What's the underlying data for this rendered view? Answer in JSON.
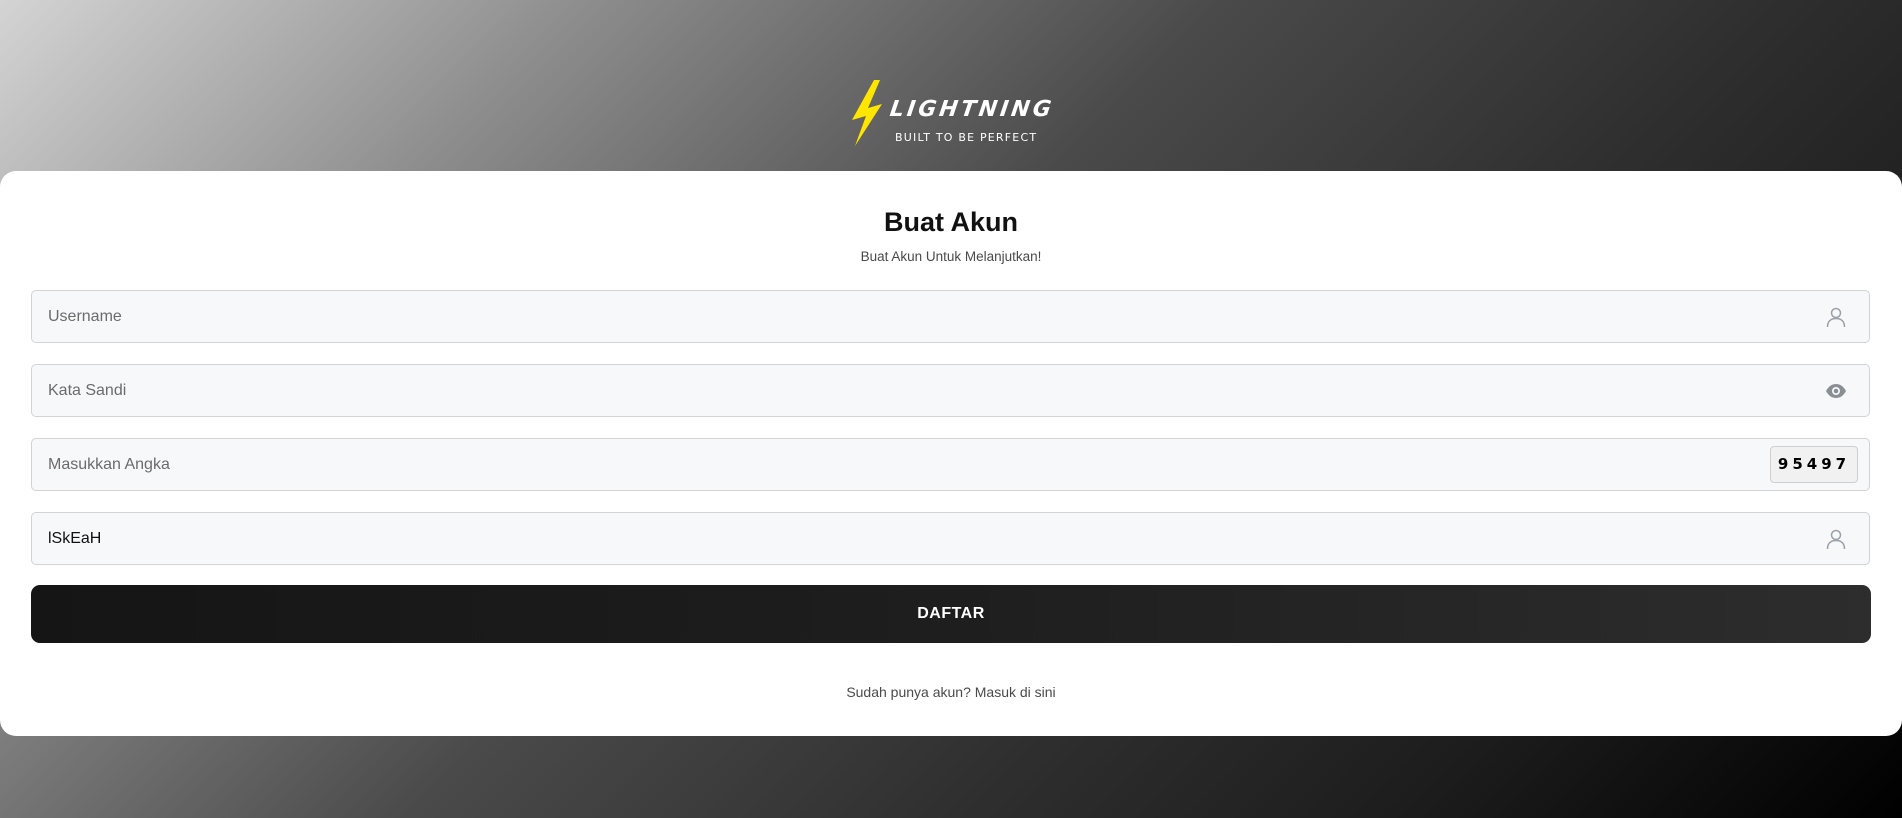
{
  "logo": {
    "wordmark": "LIGHTNING",
    "tagline": "BUILT TO BE PERFECT",
    "bolt_color": "#ffe600"
  },
  "form": {
    "title": "Buat Akun",
    "subtitle": "Buat Akun Untuk Melanjutkan!",
    "username": {
      "placeholder": "Username",
      "value": "",
      "icon": "user-icon"
    },
    "password": {
      "placeholder": "Kata Sandi",
      "value": "",
      "icon": "eye-icon"
    },
    "captcha": {
      "placeholder": "Masukkan Angka",
      "value": "",
      "code": "95497"
    },
    "referral": {
      "placeholder": "",
      "value": "lSkEaH",
      "icon": "user-icon"
    },
    "submit_label": "DAFTAR",
    "login_prompt": "Sudah punya akun? Masuk di sini"
  },
  "colors": {
    "card_background": "#ffffff",
    "button_background": "#1e1e1e",
    "field_background": "#f7f8fa"
  }
}
